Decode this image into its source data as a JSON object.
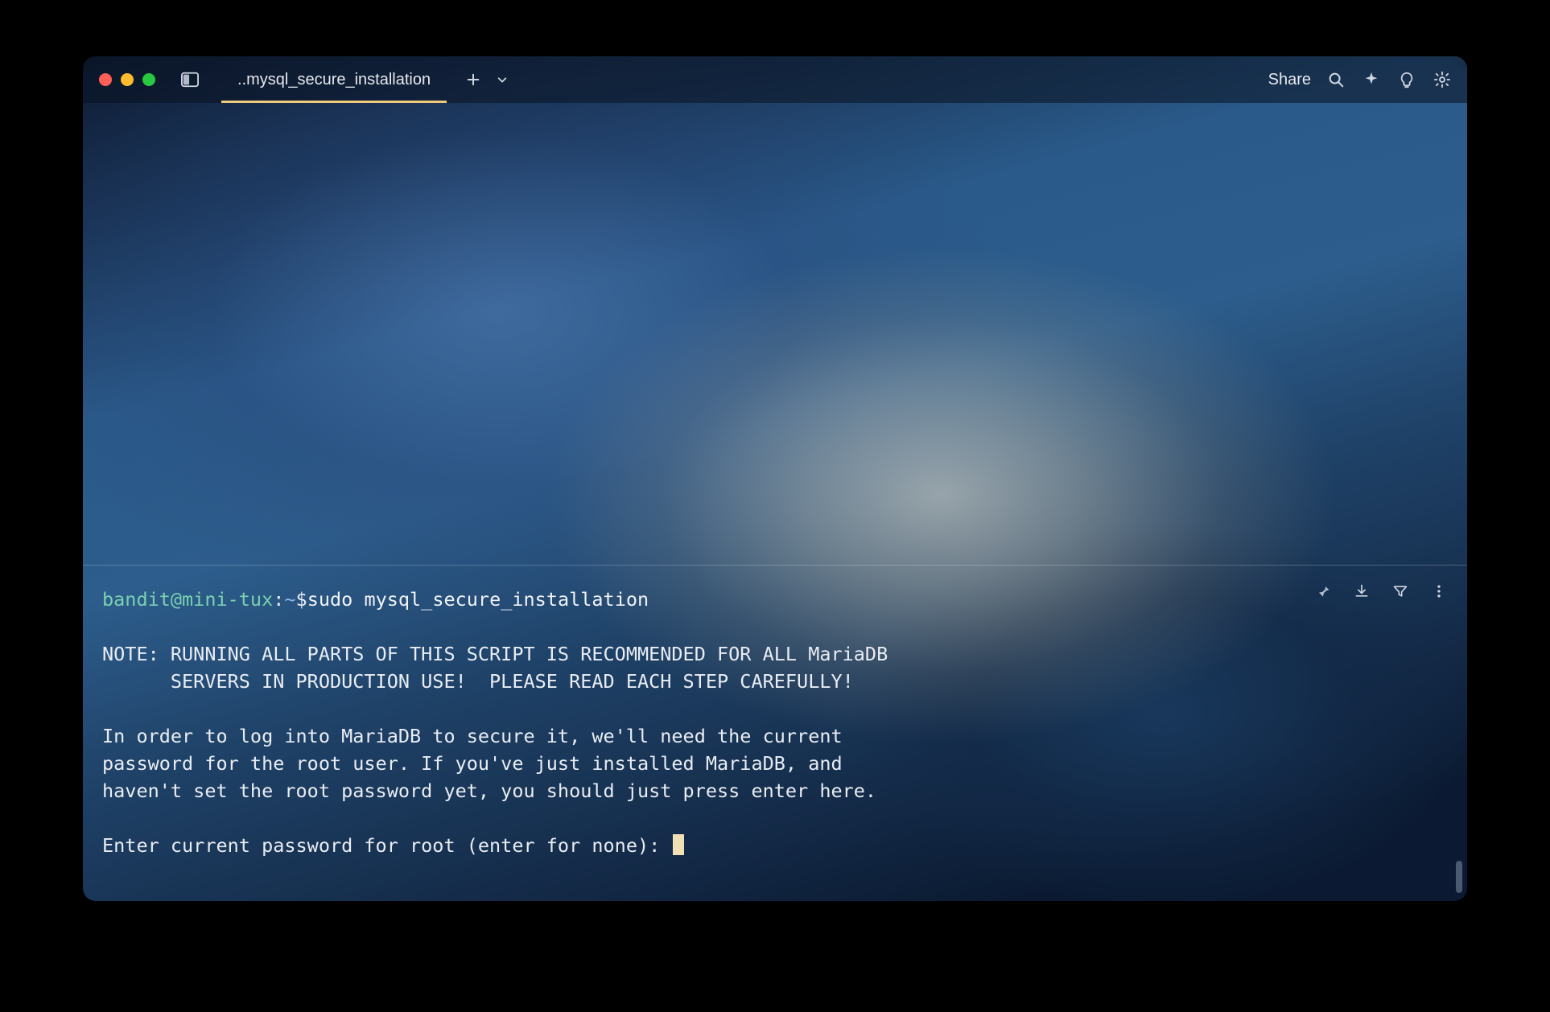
{
  "titlebar": {
    "tab_label": "..mysql_secure_installation",
    "share_label": "Share"
  },
  "icons": {
    "pane": "split-pane-icon",
    "plus": "plus-icon",
    "chevron": "chevron-down-icon",
    "search": "search-icon",
    "sparkle": "sparkle-icon",
    "bulb": "lightbulb-icon",
    "gear": "gear-icon",
    "pin": "pin-icon",
    "download": "download-icon",
    "filter": "filter-icon",
    "more": "more-vertical-icon"
  },
  "prompt": {
    "user_host": "bandit@mini-tux",
    "separator1": ":",
    "path": "~",
    "separator2": "$ ",
    "command": "sudo mysql_secure_installation"
  },
  "output": {
    "line1": "NOTE: RUNNING ALL PARTS OF THIS SCRIPT IS RECOMMENDED FOR ALL MariaDB",
    "line2": "      SERVERS IN PRODUCTION USE!  PLEASE READ EACH STEP CAREFULLY!",
    "line3": "In order to log into MariaDB to secure it, we'll need the current",
    "line4": "password for the root user. If you've just installed MariaDB, and",
    "line5": "haven't set the root password yet, you should just press enter here.",
    "line6": "Enter current password for root (enter for none): "
  },
  "colors": {
    "tab_underline": "#f0c97d",
    "prompt_user": "#7ad0b0",
    "prompt_path": "#8fb4e6",
    "cursor": "#f2e0b5"
  }
}
